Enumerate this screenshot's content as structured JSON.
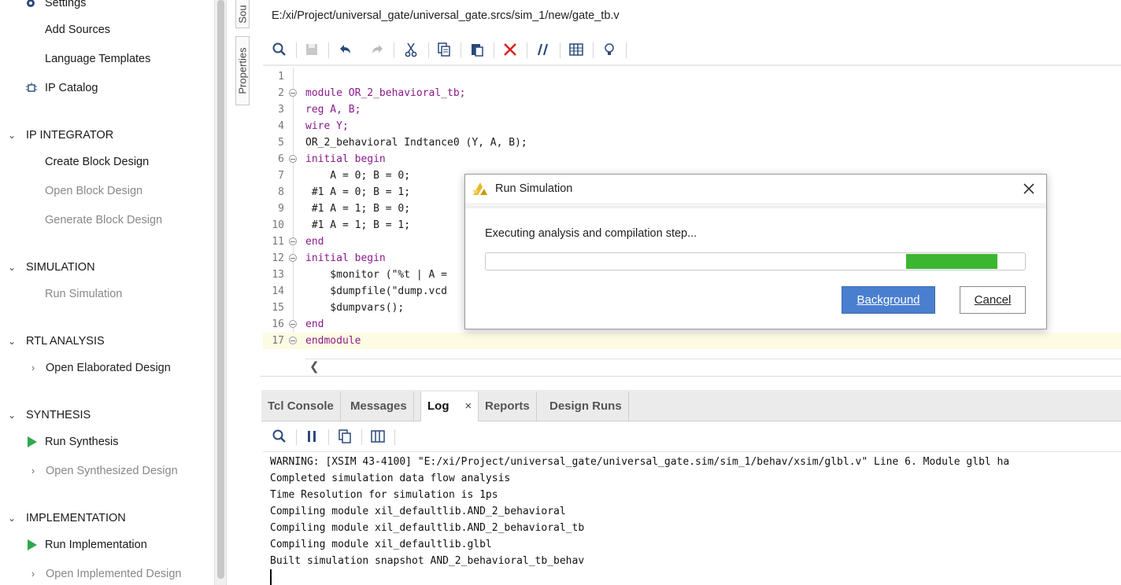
{
  "flow_nav": {
    "settings_label": "Settings",
    "add_sources_label": "Add Sources",
    "language_templates_label": "Language Templates",
    "ip_catalog_label": "IP Catalog",
    "ip_integrator": {
      "header": "IP INTEGRATOR",
      "create_block_design": "Create Block Design",
      "open_block_design": "Open Block Design",
      "generate_block_design": "Generate Block Design"
    },
    "simulation": {
      "header": "SIMULATION",
      "run_simulation": "Run Simulation"
    },
    "rtl_analysis": {
      "header": "RTL ANALYSIS",
      "open_elaborated_design": "Open Elaborated Design"
    },
    "synthesis": {
      "header": "SYNTHESIS",
      "run_synthesis": "Run Synthesis",
      "open_synthesized_design": "Open Synthesized Design"
    },
    "implementation": {
      "header": "IMPLEMENTATION",
      "run_implementation": "Run Implementation",
      "open_implemented_design": "Open Implemented Design"
    }
  },
  "side_tabs": {
    "sources": "Sou",
    "properties": "Properties"
  },
  "editor": {
    "file_path": "E:/xi/Project/universal_gate/universal_gate.srcs/sim_1/new/gate_tb.v",
    "toolbar_icons": [
      "search-icon",
      "save-icon",
      "undo-icon",
      "redo-icon",
      "cut-icon",
      "copy-icon",
      "paste-icon",
      "delete-icon",
      "comment-icon",
      "columns-icon",
      "lightbulb-icon"
    ],
    "lines": [
      {
        "num": "1",
        "fold": false,
        "text": ""
      },
      {
        "num": "2",
        "fold": true,
        "text": "module OR_2_behavioral_tb;"
      },
      {
        "num": "3",
        "fold": false,
        "text": "reg A, B;"
      },
      {
        "num": "4",
        "fold": false,
        "text": "wire Y;"
      },
      {
        "num": "5",
        "fold": false,
        "text": "OR_2_behavioral Indtance0 (Y, A, B);"
      },
      {
        "num": "6",
        "fold": true,
        "text": "initial begin"
      },
      {
        "num": "7",
        "fold": false,
        "text": "    A = 0; B = 0;"
      },
      {
        "num": "8",
        "fold": false,
        "text": " #1 A = 0; B = 1;"
      },
      {
        "num": "9",
        "fold": false,
        "text": " #1 A = 1; B = 0;"
      },
      {
        "num": "10",
        "fold": false,
        "text": " #1 A = 1; B = 1;"
      },
      {
        "num": "11",
        "fold": true,
        "text": "end"
      },
      {
        "num": "12",
        "fold": true,
        "text": "initial begin"
      },
      {
        "num": "13",
        "fold": false,
        "text": "    $monitor (\"%t | A ="
      },
      {
        "num": "14",
        "fold": false,
        "text": "    $dumpfile(\"dump.vcd"
      },
      {
        "num": "15",
        "fold": false,
        "text": "    $dumpvars();"
      },
      {
        "num": "16",
        "fold": true,
        "text": "end"
      },
      {
        "num": "17",
        "fold": true,
        "text": "endmodule"
      }
    ]
  },
  "bottom_panel": {
    "tabs": [
      {
        "label": "Tcl Console",
        "active": false
      },
      {
        "label": "Messages",
        "active": false
      },
      {
        "label": "Log",
        "active": true
      },
      {
        "label": "Reports",
        "active": false
      },
      {
        "label": "Design Runs",
        "active": false
      }
    ],
    "close_glyph": "×",
    "toolbar_icons": [
      "search-icon",
      "pause-icon",
      "copy-icon",
      "columns-icon"
    ],
    "log_lines": [
      "WARNING: [XSIM 43-4100] \"E:/xi/Project/universal_gate/universal_gate.sim/sim_1/behav/xsim/glbl.v\" Line 6. Module glbl ha",
      "Completed simulation data flow analysis",
      "Time Resolution for simulation is 1ps",
      "Compiling module xil_defaultlib.AND_2_behavioral",
      "Compiling module xil_defaultlib.AND_2_behavioral_tb",
      "Compiling module xil_defaultlib.glbl",
      "Built simulation snapshot AND_2_behavioral_tb_behav"
    ]
  },
  "dialog": {
    "title": "Run Simulation",
    "message": "Executing analysis and compilation step...",
    "progress": {
      "indeterminate": true,
      "fill_fraction": 0.17,
      "fill_start_fraction": 0.78
    },
    "background_button": "Background",
    "cancel_button": "Cancel",
    "accent_color": "#4a7fcf",
    "progress_color": "#3cb531"
  },
  "colors": {
    "run_arrow": "#2fa84f",
    "delete_icon": "#e02020",
    "icon_blue": "#2a4a7a",
    "keyword": "#8a1a8a"
  }
}
